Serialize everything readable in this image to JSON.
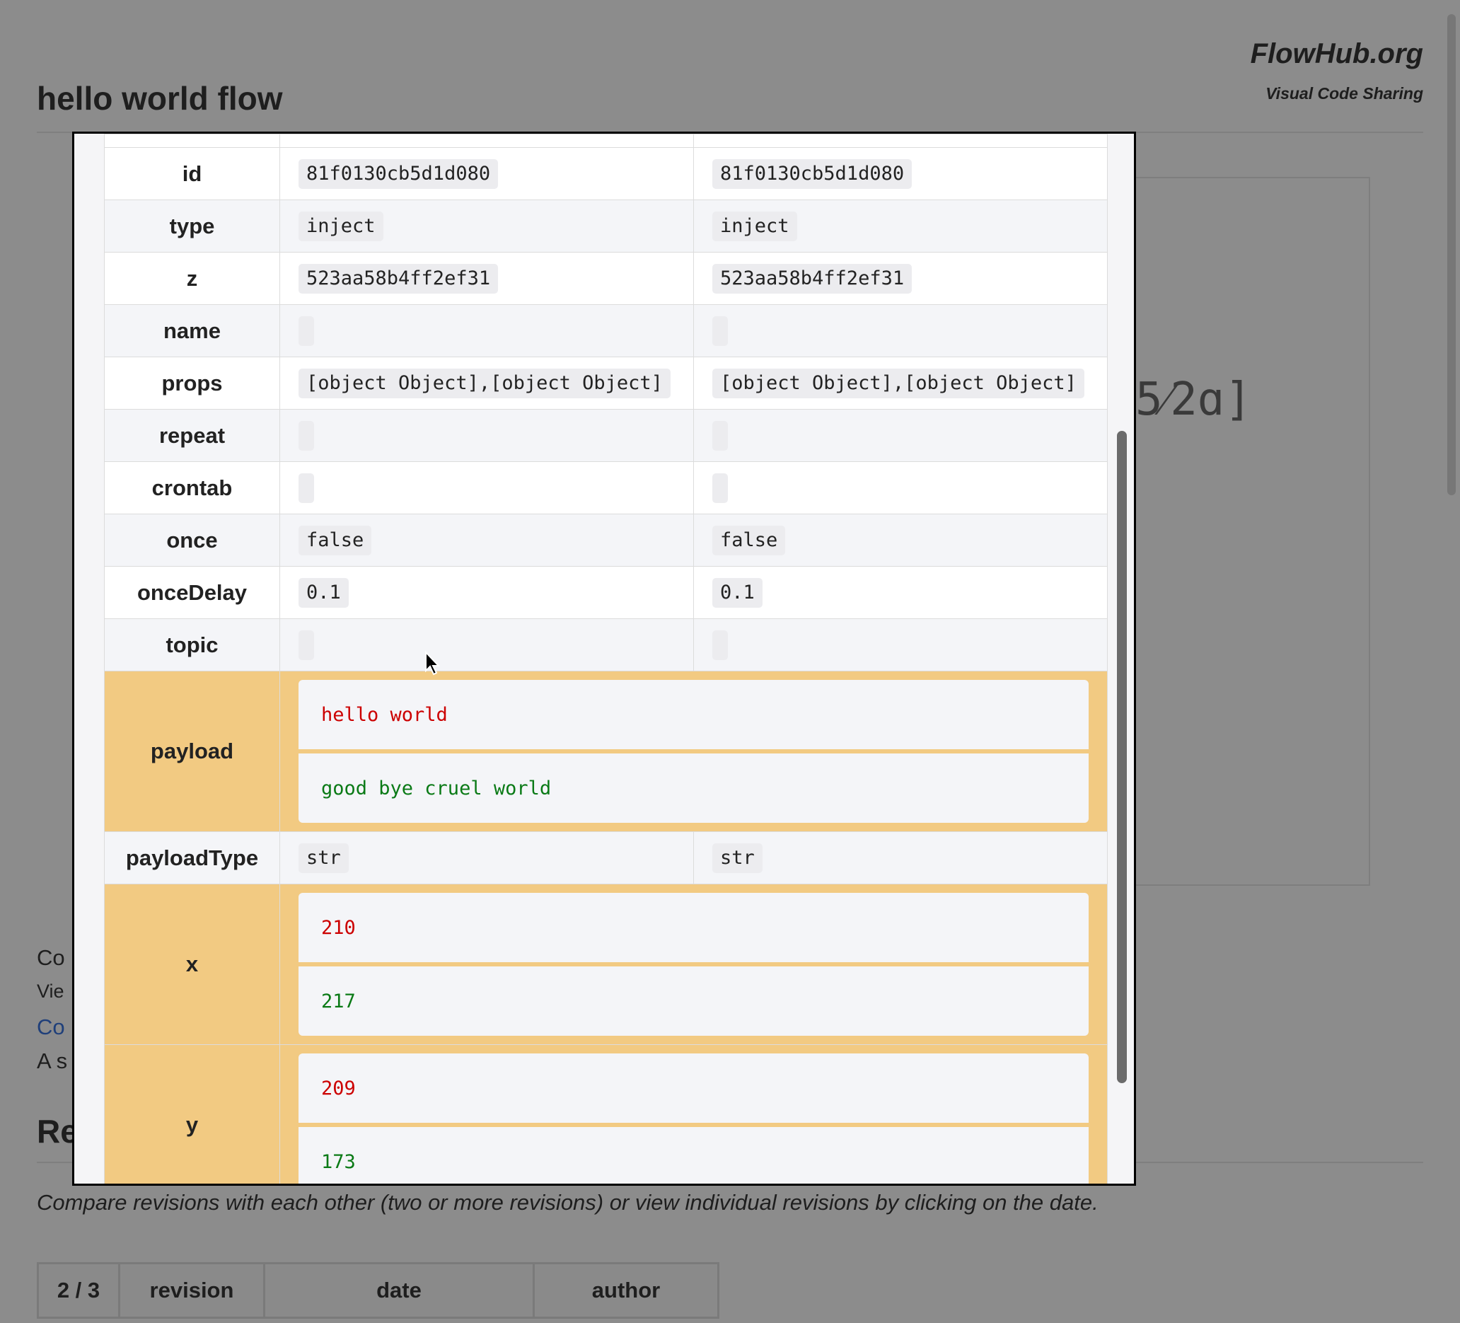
{
  "site": {
    "name": "FlowHub.org",
    "tagline": "Visual Code Sharing"
  },
  "page": {
    "title": "hello world flow"
  },
  "background": {
    "mono_fragment": "5⁄2ɑ]",
    "truncated_lines": [
      "Co",
      "Vie",
      "Co",
      "A s"
    ],
    "section_title": "Re",
    "hint": "Compare revisions with each other (two or more revisions) or view individual revisions by clicking on the date.",
    "revision_table_headers": [
      "2 / 3",
      "revision",
      "date",
      "author"
    ]
  },
  "diff": {
    "rows": [
      {
        "key": "id",
        "left": "81f0130cb5d1d080",
        "right": "81f0130cb5d1d080"
      },
      {
        "key": "type",
        "left": "inject",
        "right": "inject"
      },
      {
        "key": "z",
        "left": "523aa58b4ff2ef31",
        "right": "523aa58b4ff2ef31"
      },
      {
        "key": "name",
        "left": "",
        "right": ""
      },
      {
        "key": "props",
        "left": "[object Object],[object Object]",
        "right": "[object Object],[object Object]"
      },
      {
        "key": "repeat",
        "left": "",
        "right": ""
      },
      {
        "key": "crontab",
        "left": "",
        "right": ""
      },
      {
        "key": "once",
        "left": "false",
        "right": "false"
      },
      {
        "key": "onceDelay",
        "left": "0.1",
        "right": "0.1"
      },
      {
        "key": "topic",
        "left": "",
        "right": ""
      }
    ],
    "payload": {
      "key": "payload",
      "removed": "hello world",
      "added": "good bye cruel world"
    },
    "payloadType": {
      "key": "payloadType",
      "left": "str",
      "right": "str"
    },
    "x": {
      "key": "x",
      "removed": "210",
      "added": "217"
    },
    "y": {
      "key": "y",
      "removed": "209",
      "added": "173"
    }
  },
  "colors": {
    "changed_row": "#f2ca82",
    "removed": "#cc0000",
    "added": "#0a7a16",
    "overlay": "#8c8c8c"
  }
}
